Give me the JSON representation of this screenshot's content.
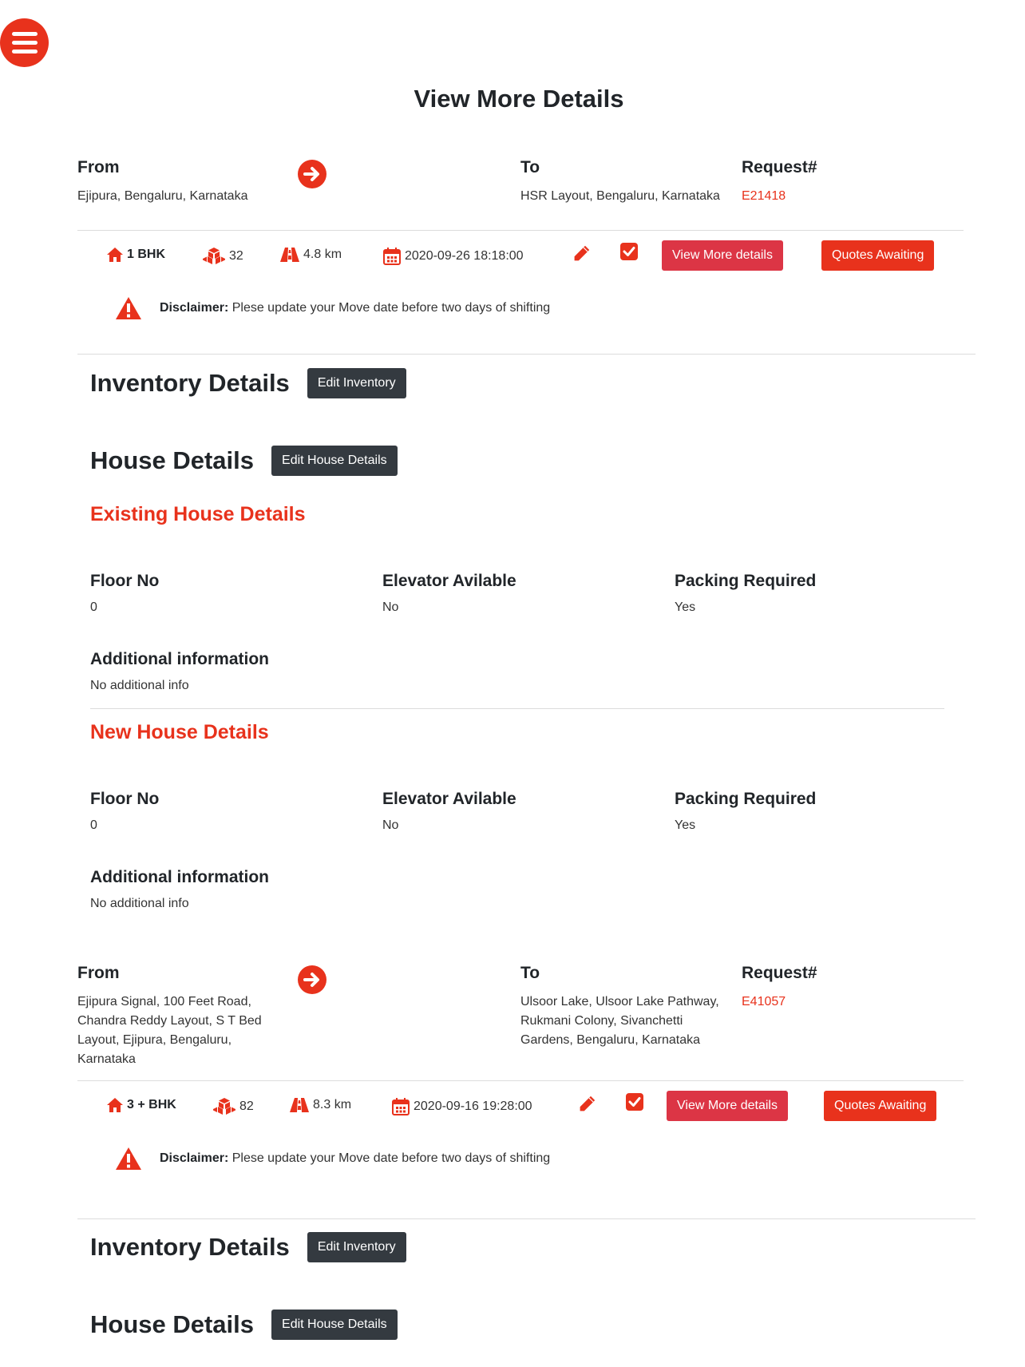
{
  "page_title": "View More Details",
  "requests": [
    {
      "from_label": "From",
      "from": "Ejipura, Bengaluru, Karnataka",
      "to_label": "To",
      "to": "HSR Layout, Bengaluru, Karnataka",
      "request_label": "Request#",
      "request_id": "E21418",
      "bhk": "1 BHK",
      "items": "32",
      "distance": "4.8 km",
      "date": "2020-09-26 18:18:00",
      "view_more": "View More details",
      "quotes": "Quotes Awaiting",
      "disclaimer_label": "Disclaimer:",
      "disclaimer_text": " Plese update your Move date before two days of shifting",
      "inventory_title": "Inventory Details",
      "edit_inventory": "Edit Inventory",
      "house_title": "House Details",
      "edit_house": "Edit House Details",
      "existing": {
        "title": "Existing House Details",
        "floor_label": "Floor No",
        "floor": "0",
        "elevator_label": "Elevator Avilable",
        "elevator": "No",
        "packing_label": "Packing Required",
        "packing": "Yes",
        "info_label": "Additional information",
        "info": "No additional info"
      },
      "new": {
        "title": "New House Details",
        "floor_label": "Floor No",
        "floor": "0",
        "elevator_label": "Elevator Avilable",
        "elevator": "No",
        "packing_label": "Packing Required",
        "packing": "Yes",
        "info_label": "Additional information",
        "info": "No additional info"
      }
    },
    {
      "from_label": "From",
      "from": "Ejipura Signal, 100 Feet Road, Chandra Reddy Layout, S T Bed Layout, Ejipura, Bengaluru, Karnataka",
      "to_label": "To",
      "to": "Ulsoor Lake, Ulsoor Lake Pathway, Rukmani Colony, Sivanchetti Gardens, Bengaluru, Karnataka",
      "request_label": "Request#",
      "request_id": "E41057",
      "bhk": "3 + BHK",
      "items": "82",
      "distance": "8.3 km",
      "date": "2020-09-16 19:28:00",
      "view_more": "View More details",
      "quotes": "Quotes Awaiting",
      "disclaimer_label": "Disclaimer:",
      "disclaimer_text": " Plese update your Move date before two days of shifting",
      "inventory_title": "Inventory Details",
      "edit_inventory": "Edit Inventory",
      "house_title": "House Details",
      "edit_house": "Edit House Details"
    }
  ],
  "colors": {
    "brand": "#e8321c",
    "view_button": "#dc3545",
    "dark_button": "#343a40"
  },
  "icons": [
    "menu-icon",
    "arrow-right-circle-icon",
    "home-icon",
    "boxes-icon",
    "road-icon",
    "calendar-icon",
    "pencil-icon",
    "checkbox-icon",
    "warning-icon"
  ]
}
